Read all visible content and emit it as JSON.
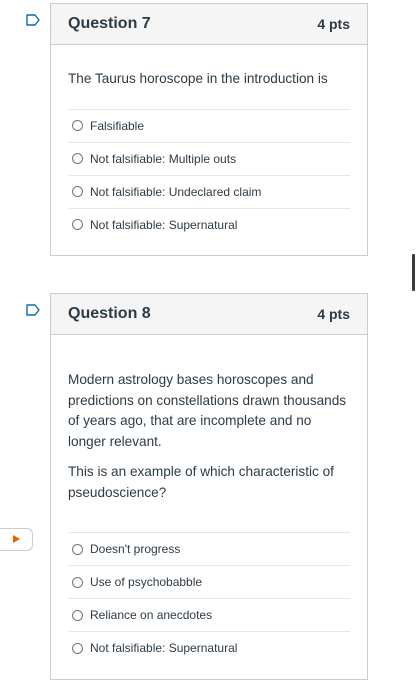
{
  "questions": [
    {
      "title": "Question 7",
      "points": "4 pts",
      "prompt": [
        "The Taurus horoscope in the introduction is"
      ],
      "answers": [
        "Falsifiable",
        "Not falsifiable: Multiple outs",
        "Not falsifiable: Undeclared claim",
        "Not falsifiable: Supernatural"
      ]
    },
    {
      "title": "Question 8",
      "points": "4 pts",
      "prompt": [
        "Modern astrology bases horoscopes and predictions on constellations drawn thousands of years ago, that are incomplete and no longer relevant.",
        "This is an example of which characteristic of pseudoscience?"
      ],
      "answers": [
        "Doesn't progress",
        "Use of psychobabble",
        "Reliance on anecdotes",
        "Not falsifiable: Supernatural"
      ]
    }
  ],
  "icons": {
    "flag": "bookmark-flag-icon",
    "nav": "play-arrow-icon"
  },
  "colors": {
    "flag_stroke": "#0770a3",
    "nav_arrow": "#e66000",
    "border": "#c7cdd1",
    "header_bg": "#f5f5f5"
  }
}
